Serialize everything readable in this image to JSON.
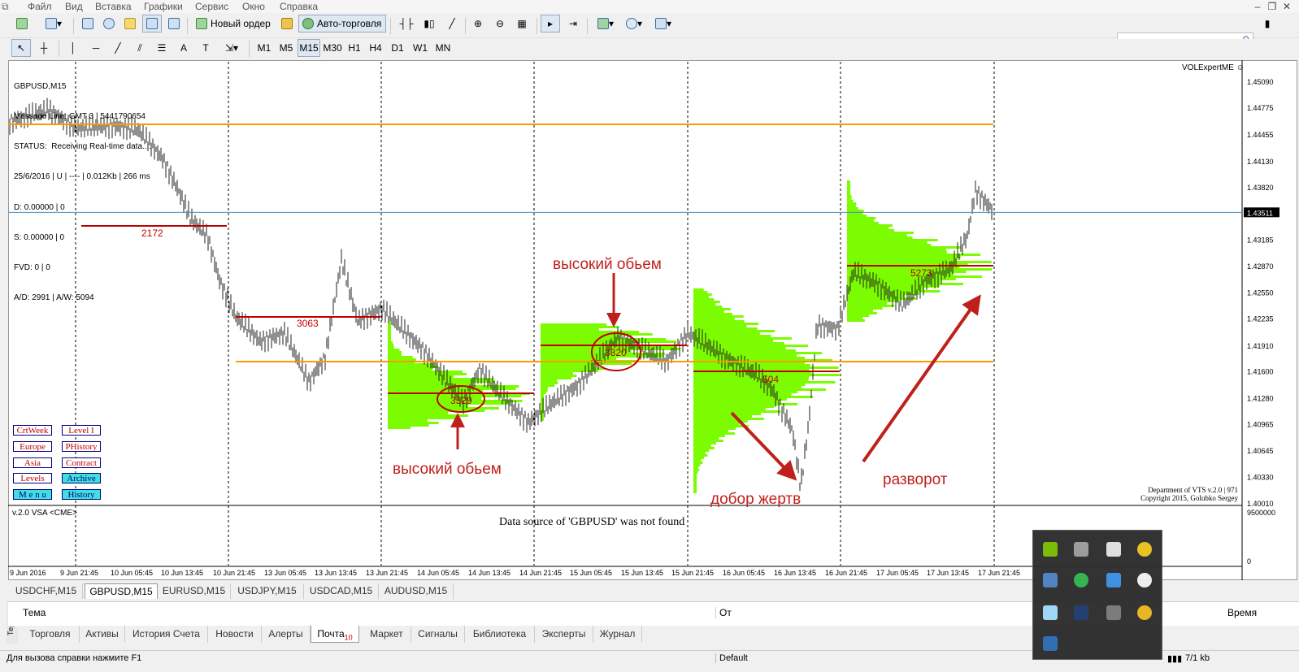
{
  "menu": [
    "Файл",
    "Вид",
    "Вставка",
    "Графики",
    "Сервис",
    "Окно",
    "Справка"
  ],
  "toolbar": {
    "new_order": "Новый ордер",
    "auto_trading": "Авто-торговля"
  },
  "timeframes": [
    "M1",
    "M5",
    "M15",
    "M30",
    "H1",
    "H4",
    "D1",
    "W1",
    "MN"
  ],
  "active_timeframe": "M15",
  "chart": {
    "title": "GBPUSD,M15",
    "info_lines": [
      "Message Line: GMT 3 | 5441790654",
      "STATUS:  Receiving Real-time data....",
      "25/6/2016 | U | ---- | 0.012Kb | 266 ms",
      "D: 0.00000 | 0",
      "S: 0.00000 | 0",
      "FVD: 0 | 0",
      "A/D: 2991 | A/W: 5094"
    ],
    "ea_name": "VOLExpertME ☺",
    "copyright": [
      "Department of VTS  v.2.0 | 971",
      "Copyright 2015, Golubko Sergey"
    ],
    "indicator_label": "v.2.0 VSA <CME>",
    "datasource_msg": "Data source of 'GBPUSD' was not found",
    "current_price": "1.43511",
    "price_ticks": [
      "1.45090",
      "1.44775",
      "1.44455",
      "1.44130",
      "1.43820",
      "1.43511",
      "1.43185",
      "1.42870",
      "1.42550",
      "1.42235",
      "1.41910",
      "1.41600",
      "1.41280",
      "1.40965",
      "1.40645",
      "1.40330",
      "1.40010"
    ],
    "sub_ticks": [
      "9500000",
      "0"
    ],
    "time_ticks": [
      "9 Jun 2016",
      "9 Jun 21:45",
      "10 Jun 05:45",
      "10 Jun 13:45",
      "10 Jun 21:45",
      "13 Jun 05:45",
      "13 Jun 13:45",
      "13 Jun 21:45",
      "14 Jun 05:45",
      "14 Jun 13:45",
      "14 Jun 21:45",
      "15 Jun 05:45",
      "15 Jun 13:45",
      "15 Jun 21:45",
      "16 Jun 05:45",
      "16 Jun 13:45",
      "16 Jun 21:45",
      "17 Jun 05:45",
      "17 Jun 13:45",
      "17 Jun 21:45"
    ],
    "volume_levels": [
      "2172",
      "3063",
      "3529",
      "3320",
      "504",
      "5273"
    ],
    "annotations": {
      "high_volume_top": "высокий обьем",
      "high_volume_bottom": "высокий обьем",
      "victims": "добор жертв",
      "reversal": "разворот"
    },
    "panel_buttons": [
      [
        "CrtWeek",
        "Level I"
      ],
      [
        "Europe",
        "PHistory"
      ],
      [
        "Asia",
        "Contract"
      ],
      [
        "Levels",
        "Archive"
      ],
      [
        "M e n u",
        "History"
      ]
    ],
    "colors": {
      "orange_level": "#ff9900",
      "red_level": "#c00000",
      "profile": "#7cfc00",
      "price_line": "#4a90c0"
    }
  },
  "chart_tabs": [
    "USDCHF,M15",
    "GBPUSD,M15",
    "EURUSD,M15",
    "USDJPY,M15",
    "USDCAD,M15",
    "AUDUSD,M15"
  ],
  "active_chart_tab": "GBPUSD,M15",
  "terminal": {
    "side_label": "Термин",
    "columns": [
      "Тема",
      "От",
      "Время"
    ],
    "tabs": [
      "Торговля",
      "Активы",
      "История Счета",
      "Новости",
      "Алерты",
      "Почта",
      "Маркет",
      "Сигналы",
      "Библиотека",
      "Эксперты",
      "Журнал"
    ],
    "mail_badge": "10"
  },
  "status": {
    "help": "Для вызова справки нажмите F1",
    "profile": "Default",
    "traffic": "7/1 kb"
  }
}
